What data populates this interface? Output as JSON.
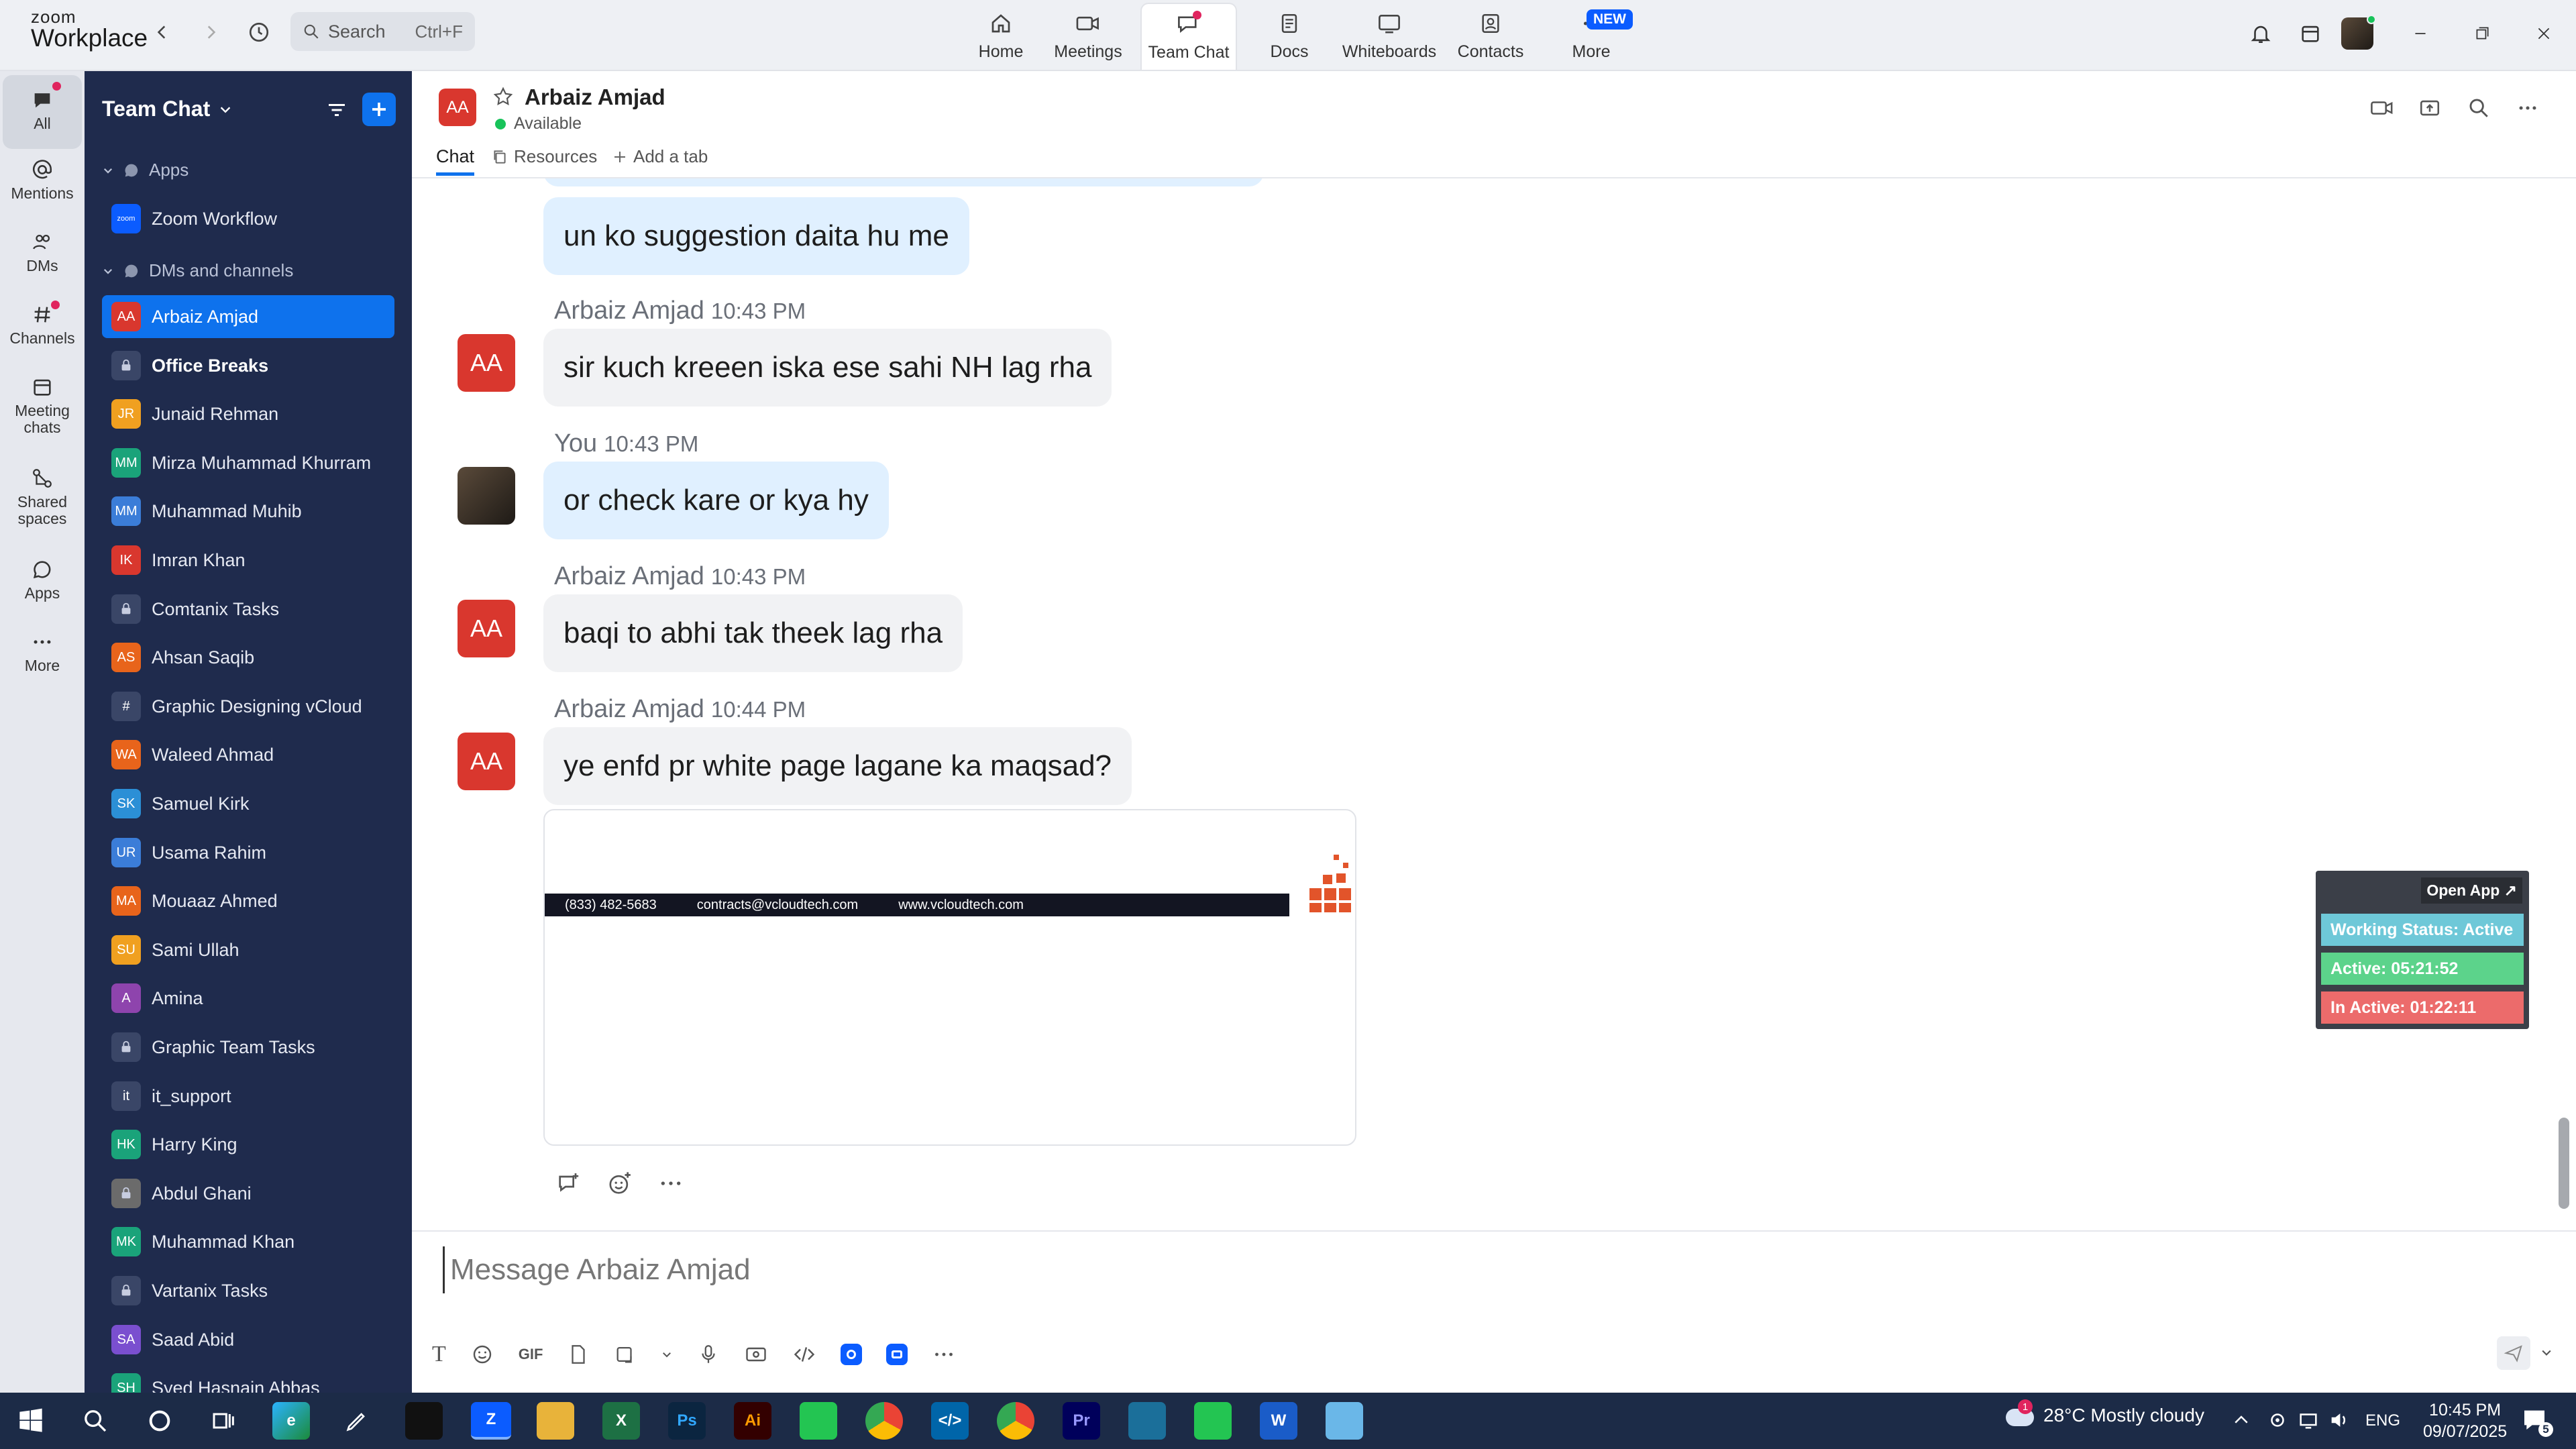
{
  "app": {
    "brand_line1": "zoom",
    "brand_line2": "Workplace"
  },
  "search": {
    "placeholder": "Search",
    "shortcut": "Ctrl+F"
  },
  "top_tabs": [
    {
      "label": "Home",
      "icon": "home-icon"
    },
    {
      "label": "Meetings",
      "icon": "video-icon"
    },
    {
      "label": "Team Chat",
      "icon": "chat-icon",
      "active": true
    },
    {
      "label": "Docs",
      "icon": "docs-icon"
    },
    {
      "label": "Whiteboards",
      "icon": "whiteboard-icon"
    },
    {
      "label": "Contacts",
      "icon": "contacts-icon"
    },
    {
      "label": "More",
      "icon": "more-icon",
      "badge": "NEW"
    }
  ],
  "rail": [
    {
      "label": "All",
      "active": true
    },
    {
      "label": "Mentions"
    },
    {
      "label": "DMs"
    },
    {
      "label": "Channels"
    },
    {
      "label": "Meeting chats"
    },
    {
      "label": "Shared spaces"
    },
    {
      "label": "Apps"
    },
    {
      "label": "More"
    }
  ],
  "sidebar": {
    "title": "Team Chat",
    "section_apps": "Apps",
    "app_item": "Zoom Workflow",
    "section_dms": "DMs and channels",
    "items": [
      {
        "name": "Arbaiz Amjad",
        "initials": "AA",
        "color": "#d9372e",
        "active": true
      },
      {
        "name": "Office Breaks",
        "initials": "",
        "color": "#3a4667",
        "bold": true
      },
      {
        "name": "Junaid Rehman",
        "initials": "JR",
        "color": "#f0a020"
      },
      {
        "name": "Mirza Muhammad Khurram",
        "initials": "MM",
        "color": "#1aa37a"
      },
      {
        "name": "Muhammad Muhib",
        "initials": "MM",
        "color": "#3b7dd8"
      },
      {
        "name": "Imran Khan",
        "initials": "IK",
        "color": "#d9372e"
      },
      {
        "name": "Comtanix Tasks",
        "initials": "",
        "color": "#3a4667"
      },
      {
        "name": "Ahsan Saqib",
        "initials": "AS",
        "color": "#e8641b"
      },
      {
        "name": "Graphic Designing vCloud",
        "initials": "#",
        "color": "#3a4667"
      },
      {
        "name": "Waleed Ahmad",
        "initials": "WA",
        "color": "#e8641b"
      },
      {
        "name": "Samuel Kirk",
        "initials": "SK",
        "color": "#2b8fd6"
      },
      {
        "name": "Usama Rahim",
        "initials": "UR",
        "color": "#3b7dd8"
      },
      {
        "name": "Mouaaz Ahmed",
        "initials": "MA",
        "color": "#e8641b"
      },
      {
        "name": "Sami Ullah",
        "initials": "SU",
        "color": "#f0a020"
      },
      {
        "name": "Amina",
        "initials": "A",
        "color": "#8e44ad"
      },
      {
        "name": "Graphic Team Tasks",
        "initials": "",
        "color": "#3a4667"
      },
      {
        "name": "it_support",
        "initials": "it",
        "color": "#3a4667"
      },
      {
        "name": "Harry King",
        "initials": "HK",
        "color": "#1aa37a"
      },
      {
        "name": "Abdul Ghani",
        "initials": "",
        "color": "#6b6b6b"
      },
      {
        "name": "Muhammad Khan",
        "initials": "MK",
        "color": "#1aa37a"
      },
      {
        "name": "Vartanix Tasks",
        "initials": "",
        "color": "#3a4667"
      },
      {
        "name": "Saad Abid",
        "initials": "SA",
        "color": "#7a4fcf"
      },
      {
        "name": "Syed Hasnain Abbas",
        "initials": "SH",
        "color": "#1aa37a"
      }
    ]
  },
  "chat": {
    "contact": "Arbaiz Amjad",
    "initials": "AA",
    "status": "Available",
    "tabs": [
      "Chat",
      "Resources",
      "Add a tab"
    ],
    "messages": [
      {
        "text": "un ko suggestion daita hu me",
        "me": true
      },
      {
        "sender": "Arbaiz Amjad",
        "time": "10:43 PM",
        "text": "sir kuch kreeen iska ese sahi NH lag rha"
      },
      {
        "sender": "You",
        "time": "10:43 PM",
        "text": "or check kare or kya hy",
        "me": true
      },
      {
        "sender": "Arbaiz Amjad",
        "time": "10:43 PM",
        "text": "baqi to abhi tak theek lag rha"
      },
      {
        "sender": "Arbaiz Amjad",
        "time": "10:44 PM",
        "text": "ye enfd pr white page lagane ka maqsad?"
      }
    ],
    "attachment": {
      "phone": "(833) 482-5683",
      "email": "contracts@vcloudtech.com",
      "web": "www.vcloudtech.com"
    },
    "composer_placeholder": "Message Arbaiz Amjad"
  },
  "widget": {
    "open_app": "Open App ↗",
    "working_status": "Working Status: Active",
    "active": "Active: 05:21:52",
    "inactive": "In Active: 01:22:11"
  },
  "taskbar": {
    "weather": "28°C  Mostly cloudy",
    "weather_badge": "1",
    "lang": "ENG",
    "time": "10:45 PM",
    "date": "09/07/2025",
    "notif_count": "5"
  }
}
